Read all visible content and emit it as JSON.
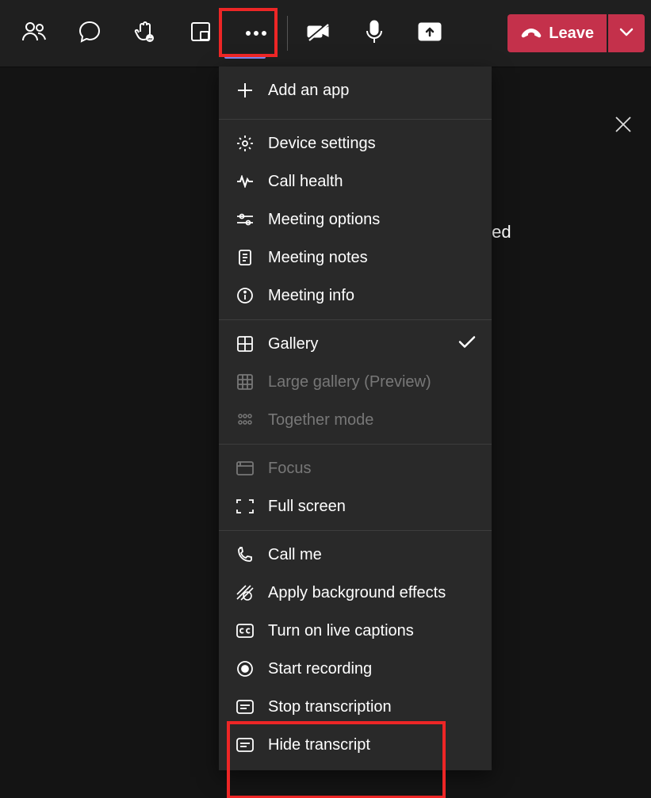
{
  "toolbar": {
    "people_icon": "people-icon",
    "chat_icon": "chat-icon",
    "raise_hand_icon": "raise-hand-icon",
    "rooms_icon": "breakout-rooms-icon",
    "more_icon": "more-icon",
    "camera_off_icon": "camera-off-icon",
    "mic_icon": "mic-icon",
    "share_icon": "share-screen-icon",
    "leave_label": "Leave",
    "leave_caret_icon": "chevron-down-icon"
  },
  "panel": {
    "close_icon": "close-icon",
    "fragment_text": "ted"
  },
  "menu": {
    "add_app": "Add an app",
    "device_settings": "Device settings",
    "call_health": "Call health",
    "meeting_options": "Meeting options",
    "meeting_notes": "Meeting notes",
    "meeting_info": "Meeting info",
    "gallery": "Gallery",
    "large_gallery": "Large gallery (Preview)",
    "together": "Together mode",
    "focus": "Focus",
    "full_screen": "Full screen",
    "call_me": "Call me",
    "bg_effects": "Apply background effects",
    "live_captions": "Turn on live captions",
    "start_recording": "Start recording",
    "stop_transcription": "Stop transcription",
    "hide_transcript": "Hide transcript"
  }
}
